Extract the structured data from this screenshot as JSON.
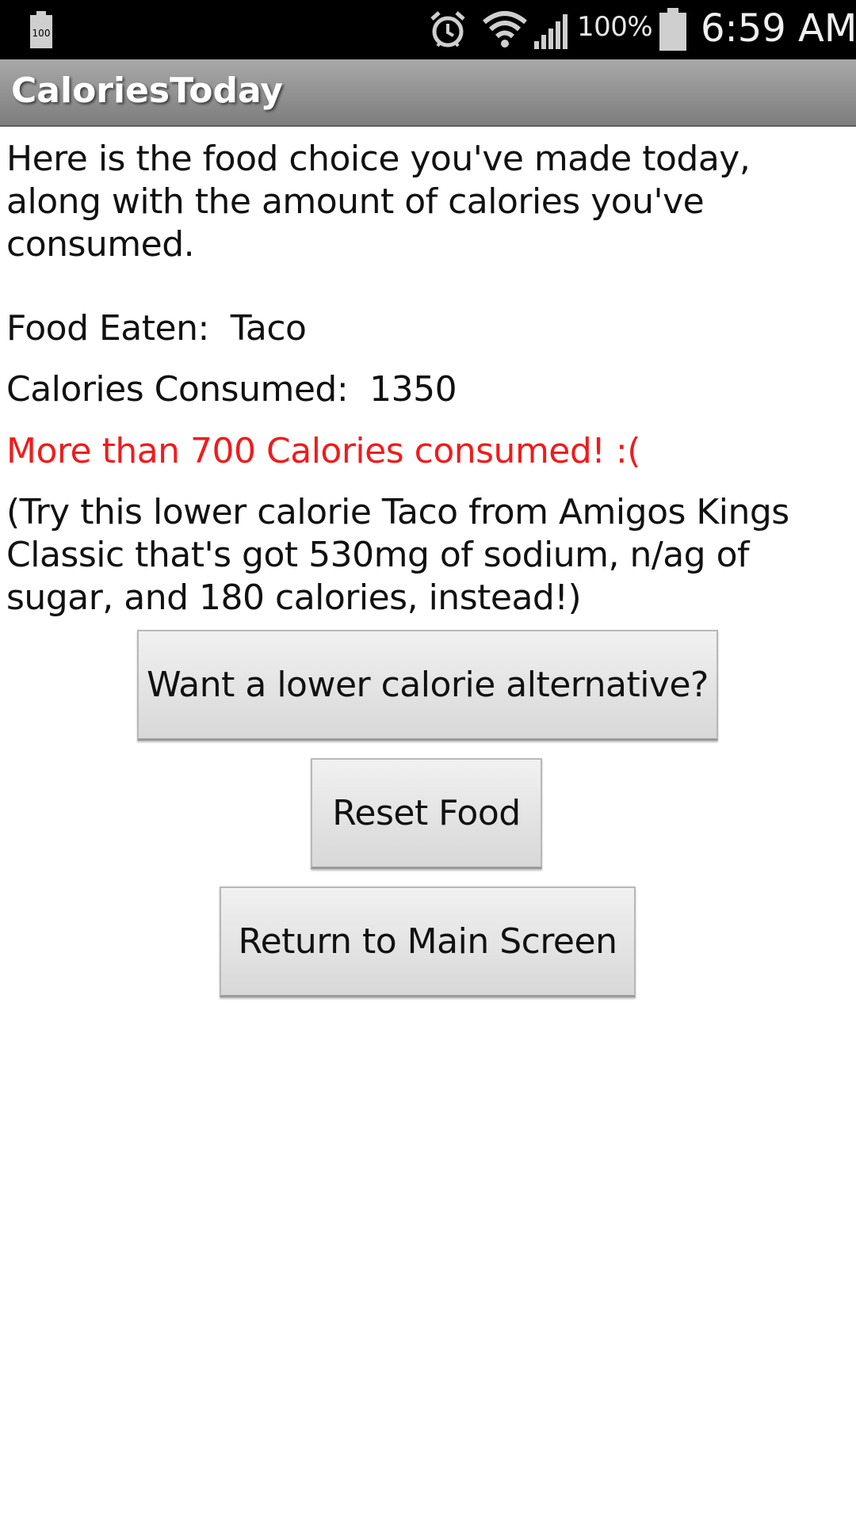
{
  "status_bar": {
    "left_battery_text": "100",
    "battery_percent": "100%",
    "time": "6:59 AM",
    "icons": [
      "battery-small-icon",
      "alarm-icon",
      "wifi-icon",
      "signal-icon",
      "battery-icon"
    ]
  },
  "app_bar": {
    "title": "CaloriesToday"
  },
  "main": {
    "intro": "Here is the food choice you've made today, along with the amount of calories you've consumed.",
    "food_eaten_label": "Food Eaten:",
    "food_eaten_value": "Taco",
    "calories_label": "Calories Consumed:",
    "calories_value": "1350",
    "warning": "More than 700 Calories consumed! :(",
    "suggestion": "(Try this lower calorie Taco from Amigos Kings Classic that's got 530mg of sodium, n/ag of sugar, and 180 calories, instead!)"
  },
  "buttons": {
    "alternative": "Want a lower calorie alternative?",
    "reset": "Reset Food",
    "return": "Return to Main Screen"
  },
  "colors": {
    "warning": "#ef1c1c",
    "status_bar": "#000000",
    "title_bar": "#8e8e8e"
  }
}
